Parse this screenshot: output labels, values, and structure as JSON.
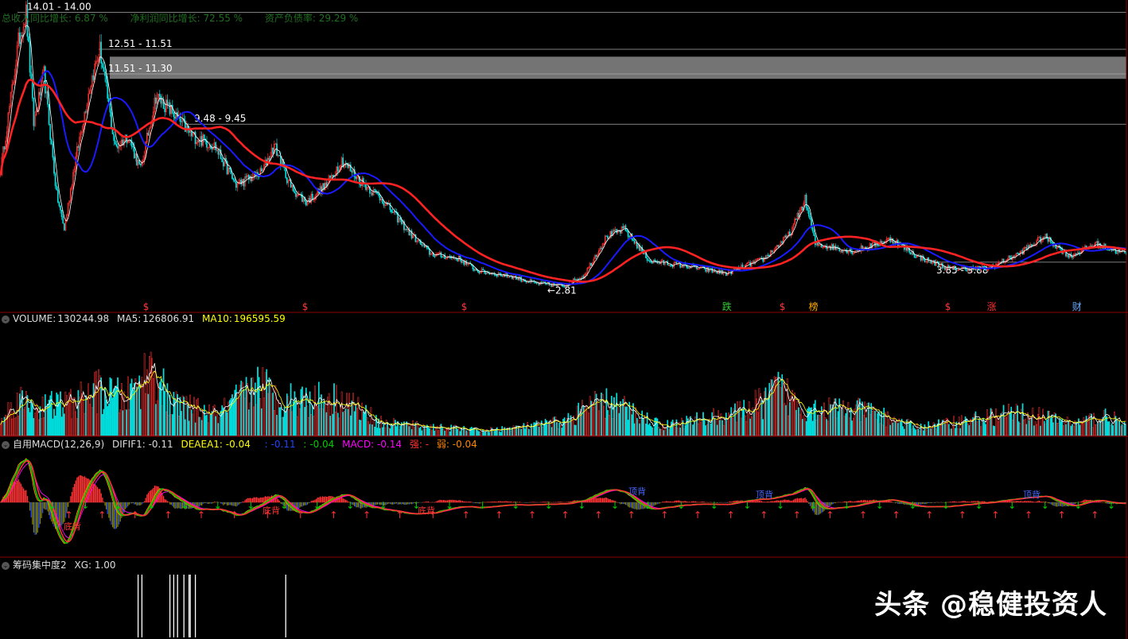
{
  "financials": {
    "row1": [
      "总收入同比增长: 6.87 %",
      "净利润同比增长: 72.55 %",
      "资产负债率: 29.29 %"
    ]
  },
  "colors": {
    "up": "#ff3333",
    "down": "#00e0e0",
    "ma_short": "#ffffff",
    "ma_mid": "#ff2222",
    "ma_long": "#1a1aff",
    "panel_border": "#8b0000",
    "zone": "#888888",
    "macd_yellow": "#ffff00",
    "macd_magenta": "#ff00ff",
    "macd_orange": "#ff8800",
    "macd_green": "#00cc00",
    "macd_blue": "#2244ff",
    "olive": "#808000"
  },
  "price_panel": {
    "levels": [
      {
        "label": "14.01 - 14.00",
        "price": 14.0
      },
      {
        "label": "12.51 - 11.51",
        "price": 12.5
      },
      {
        "label": "11.51 - 11.30",
        "price": 11.5
      },
      {
        "label": "9.48 - 9.45",
        "price": 9.46
      },
      {
        "label": "3.85 - 3.88",
        "price": 3.86
      }
    ],
    "zone": {
      "low": 11.3,
      "high": 12.2
    },
    "low_label": "←2.81",
    "event_markers": [
      {
        "text": "$",
        "idx": 115,
        "color": "#ff3333"
      },
      {
        "text": "$",
        "idx": 240,
        "color": "#ff3333"
      },
      {
        "text": "$",
        "idx": 365,
        "color": "#ff3333"
      },
      {
        "text": "跌",
        "idx": 570,
        "color": "#33cc33"
      },
      {
        "text": "$",
        "idx": 615,
        "color": "#ff3333"
      },
      {
        "text": "榜",
        "idx": 638,
        "color": "#ffaa00"
      },
      {
        "text": "$",
        "idx": 745,
        "color": "#ff3333"
      },
      {
        "text": "涨",
        "idx": 778,
        "color": "#ff3333"
      },
      {
        "text": "财",
        "idx": 845,
        "color": "#66aaff"
      }
    ]
  },
  "volume_panel": {
    "name": "VOLUME:",
    "value": "130244.98",
    "ma5_label": "MA5:",
    "ma5_value": "126806.91",
    "ma10_label": "MA10:",
    "ma10_value": "196595.59"
  },
  "macd_panel": {
    "name": "自用MACD(12,26,9)",
    "difif1": "DIFIF1: -0.11",
    "deaea1": "DEAEA1: -0.04",
    "blue_val": ": -0.11",
    "green_val": ": -0.04",
    "macd": "MACD: -0.14",
    "strong": "强: -",
    "weak": "弱: -0.04",
    "signal_labels": [
      "底背",
      "底背",
      "底背",
      "顶背",
      "顶背",
      "顶背"
    ]
  },
  "chip_panel": {
    "name": "筹码集中度2",
    "xg": "XG: 1.00"
  },
  "watermark": "头条 @稳健投资人",
  "chart_data": {
    "type": "candlestick",
    "description_series": [
      {
        "name": "K线"
      },
      {
        "name": "VOLUME"
      },
      {
        "name": "MACD"
      },
      {
        "name": "XG"
      }
    ],
    "price_anchors": [
      [
        0,
        7.6
      ],
      [
        8,
        10.5
      ],
      [
        14,
        12.8
      ],
      [
        20,
        14.0
      ],
      [
        26,
        9.5
      ],
      [
        34,
        11.5
      ],
      [
        44,
        6.6
      ],
      [
        50,
        5.2
      ],
      [
        58,
        7.8
      ],
      [
        70,
        11.0
      ],
      [
        78,
        12.5
      ],
      [
        90,
        8.5
      ],
      [
        100,
        9.0
      ],
      [
        110,
        7.6
      ],
      [
        122,
        10.6
      ],
      [
        134,
        10.0
      ],
      [
        150,
        9.0
      ],
      [
        168,
        8.6
      ],
      [
        185,
        7.0
      ],
      [
        205,
        7.5
      ],
      [
        215,
        8.6
      ],
      [
        228,
        6.9
      ],
      [
        240,
        6.3
      ],
      [
        256,
        7.0
      ],
      [
        268,
        8.0
      ],
      [
        282,
        7.2
      ],
      [
        300,
        6.4
      ],
      [
        322,
        5.0
      ],
      [
        338,
        4.2
      ],
      [
        360,
        4.0
      ],
      [
        375,
        3.5
      ],
      [
        400,
        3.3
      ],
      [
        420,
        3.0
      ],
      [
        442,
        2.9
      ],
      [
        458,
        3.3
      ],
      [
        476,
        4.9
      ],
      [
        490,
        5.2
      ],
      [
        510,
        3.9
      ],
      [
        540,
        3.7
      ],
      [
        570,
        3.4
      ],
      [
        600,
        4.0
      ],
      [
        620,
        5.0
      ],
      [
        632,
        6.4
      ],
      [
        640,
        4.6
      ],
      [
        670,
        4.3
      ],
      [
        700,
        4.8
      ],
      [
        720,
        4.1
      ],
      [
        745,
        3.6
      ],
      [
        775,
        3.6
      ],
      [
        800,
        4.2
      ],
      [
        820,
        4.9
      ],
      [
        840,
        4.1
      ],
      [
        860,
        4.6
      ],
      [
        884,
        4.2
      ]
    ],
    "price_range": [
      2.5,
      14.5
    ],
    "n_bars": 885,
    "volume_peaks": [
      [
        0,
        0.15
      ],
      [
        12,
        0.45
      ],
      [
        30,
        0.35
      ],
      [
        58,
        0.4
      ],
      [
        75,
        0.55
      ],
      [
        98,
        0.45
      ],
      [
        120,
        0.85
      ],
      [
        132,
        0.4
      ],
      [
        170,
        0.25
      ],
      [
        205,
        0.65
      ],
      [
        214,
        0.45
      ],
      [
        268,
        0.45
      ],
      [
        300,
        0.15
      ],
      [
        380,
        0.06
      ],
      [
        420,
        0.12
      ],
      [
        445,
        0.18
      ],
      [
        460,
        0.35
      ],
      [
        480,
        0.4
      ],
      [
        520,
        0.12
      ],
      [
        580,
        0.28
      ],
      [
        600,
        0.42
      ],
      [
        610,
        0.58
      ],
      [
        630,
        0.35
      ],
      [
        680,
        0.3
      ],
      [
        720,
        0.1
      ],
      [
        800,
        0.28
      ],
      [
        845,
        0.15
      ],
      [
        870,
        0.25
      ],
      [
        884,
        0.1
      ]
    ],
    "volume_range": [
      0,
      1
    ],
    "xg_bars": [
      108,
      111,
      133,
      136,
      139,
      144,
      148,
      149,
      153,
      224
    ]
  }
}
